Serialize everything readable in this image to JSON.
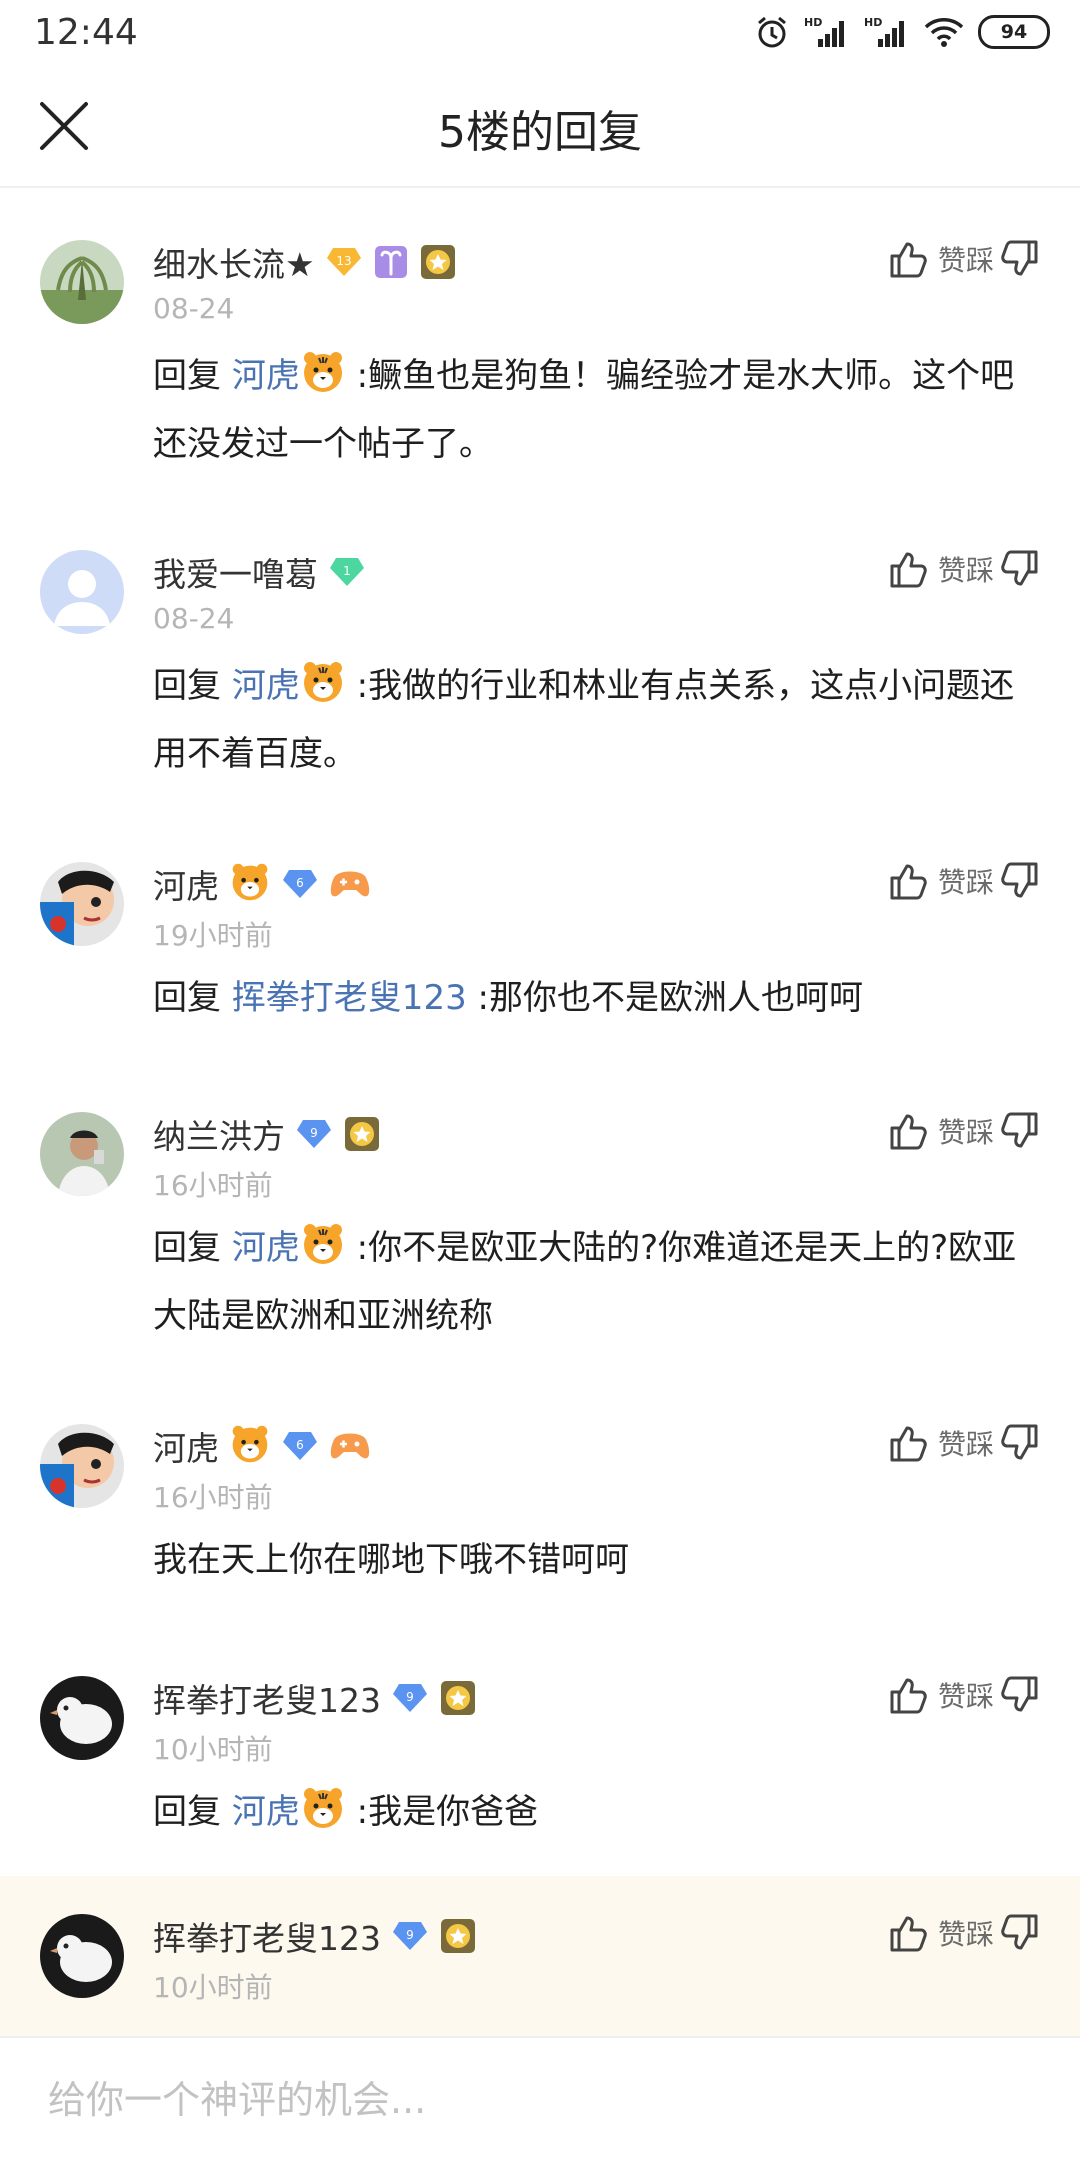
{
  "status_bar": {
    "time": "12:44",
    "battery": "94",
    "network_1": "HD",
    "network_2": "HD"
  },
  "header": {
    "title": "5楼的回复"
  },
  "actions": {
    "label": "赞踩"
  },
  "replies": [
    {
      "username": "细水长流★",
      "level": "13",
      "time": "08-24",
      "prefix": "回复 ",
      "mention": "河虎",
      "text": " :鳜鱼也是狗鱼！骗经验才是水大师。这个吧还没发过一个帖子了。"
    },
    {
      "username": "我爱一噜葛",
      "level": "1",
      "time": "08-24",
      "prefix": "回复 ",
      "mention": "河虎",
      "text": " :我做的行业和林业有点关系，这点小问题还用不着百度。"
    },
    {
      "username": "河虎",
      "level": "6",
      "time": "19小时前",
      "prefix": "回复 ",
      "mention": "挥拳打老叟123",
      "text": " :那你也不是欧洲人也呵呵"
    },
    {
      "username": "纳兰洪方",
      "level": "9",
      "time": "16小时前",
      "prefix": "回复 ",
      "mention": "河虎",
      "text": " :你不是欧亚大陆的?你难道还是天上的?欧亚大陆是欧洲和亚洲统称"
    },
    {
      "username": "河虎",
      "level": "6",
      "time": "16小时前",
      "text": "我在天上你在哪地下哦不错呵呵"
    },
    {
      "username": "挥拳打老叟123",
      "level": "9",
      "time": "10小时前",
      "prefix": "回复 ",
      "mention": "河虎",
      "text": " :我是你爸爸"
    },
    {
      "username": "挥拳打老叟123",
      "level": "9",
      "time": "10小时前"
    }
  ],
  "input": {
    "placeholder": "给你一个神评的机会..."
  }
}
